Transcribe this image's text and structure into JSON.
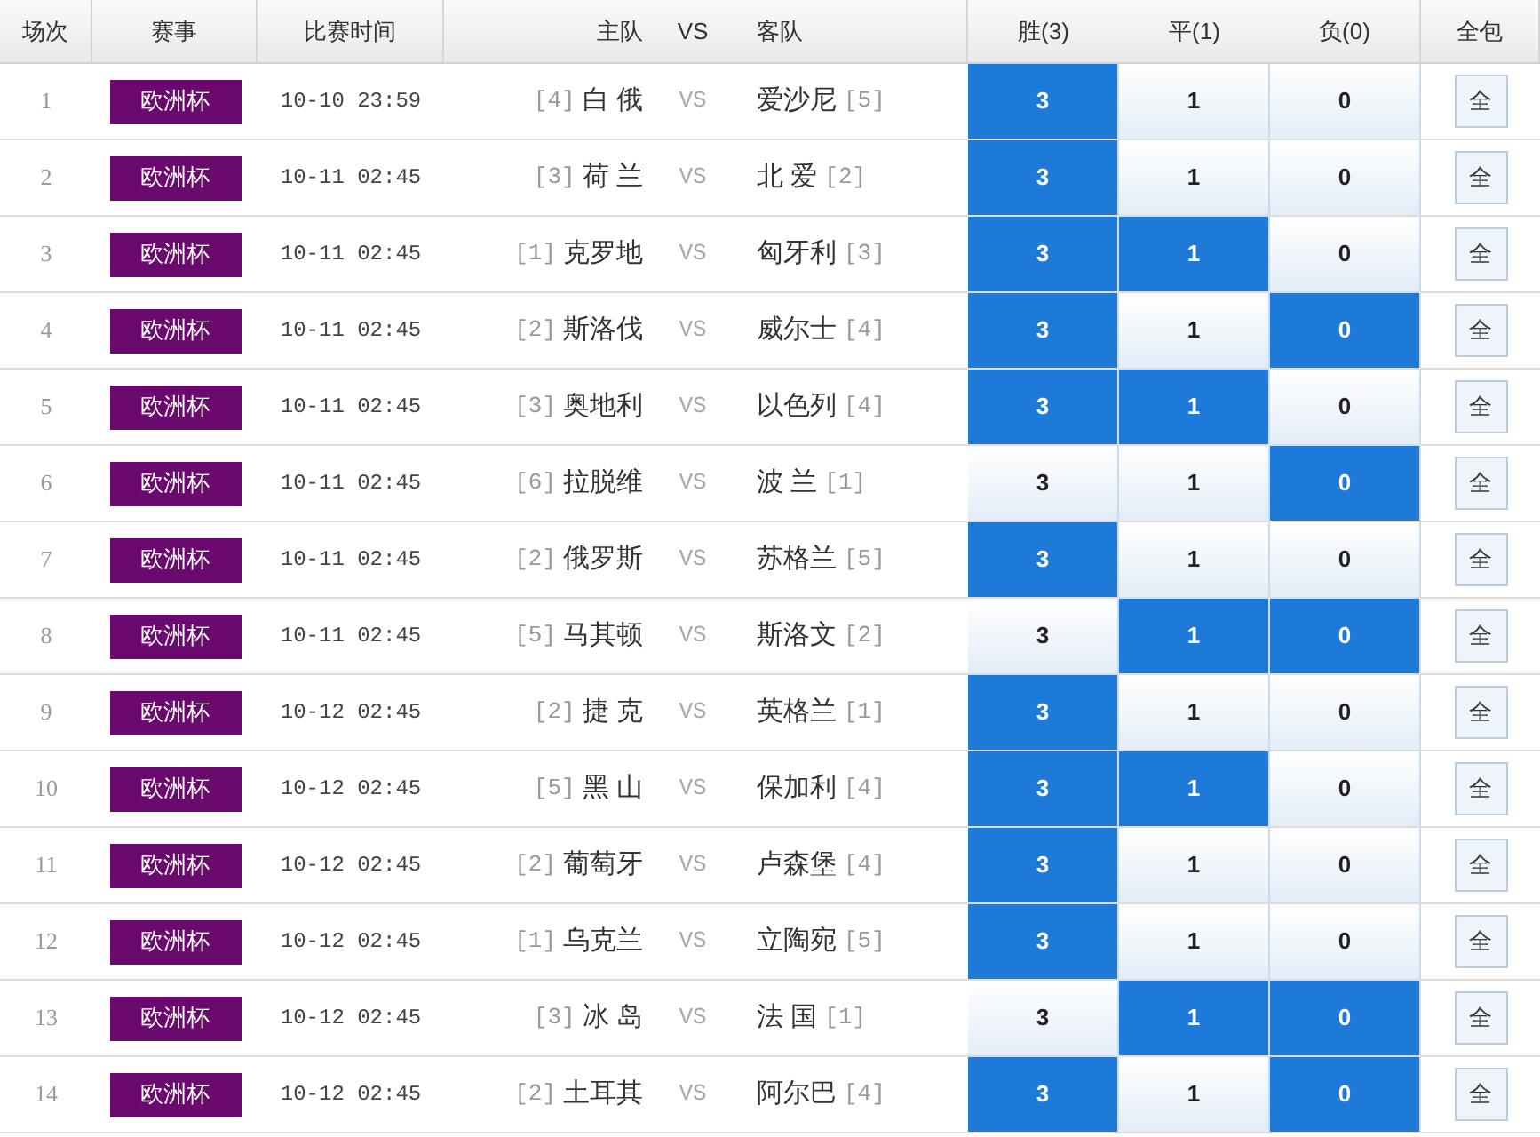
{
  "columns": [
    "场次",
    "赛事",
    "比赛时间",
    "主队",
    "VS",
    "客队",
    "胜(3)",
    "平(1)",
    "负(0)",
    "全包"
  ],
  "rows": [
    {
      "no": "1",
      "league": "欧洲杯",
      "time": "10-10 23:59",
      "home_rank": "[4]",
      "home": "白 俄",
      "vs": "VS",
      "away": "爱沙尼",
      "away_rank": "[5]",
      "odds": [
        {
          "value": "3",
          "selected": true
        },
        {
          "value": "1",
          "selected": false
        },
        {
          "value": "0",
          "selected": false
        }
      ],
      "all": "全"
    },
    {
      "no": "2",
      "league": "欧洲杯",
      "time": "10-11 02:45",
      "home_rank": "[3]",
      "home": "荷 兰",
      "vs": "VS",
      "away": "北 爱",
      "away_rank": "[2]",
      "odds": [
        {
          "value": "3",
          "selected": true
        },
        {
          "value": "1",
          "selected": false
        },
        {
          "value": "0",
          "selected": false
        }
      ],
      "all": "全"
    },
    {
      "no": "3",
      "league": "欧洲杯",
      "time": "10-11 02:45",
      "home_rank": "[1]",
      "home": "克罗地",
      "vs": "VS",
      "away": "匈牙利",
      "away_rank": "[3]",
      "odds": [
        {
          "value": "3",
          "selected": true
        },
        {
          "value": "1",
          "selected": true
        },
        {
          "value": "0",
          "selected": false
        }
      ],
      "all": "全"
    },
    {
      "no": "4",
      "league": "欧洲杯",
      "time": "10-11 02:45",
      "home_rank": "[2]",
      "home": "斯洛伐",
      "vs": "VS",
      "away": "威尔士",
      "away_rank": "[4]",
      "odds": [
        {
          "value": "3",
          "selected": true
        },
        {
          "value": "1",
          "selected": false
        },
        {
          "value": "0",
          "selected": true
        }
      ],
      "all": "全"
    },
    {
      "no": "5",
      "league": "欧洲杯",
      "time": "10-11 02:45",
      "home_rank": "[3]",
      "home": "奥地利",
      "vs": "VS",
      "away": "以色列",
      "away_rank": "[4]",
      "odds": [
        {
          "value": "3",
          "selected": true
        },
        {
          "value": "1",
          "selected": true
        },
        {
          "value": "0",
          "selected": false
        }
      ],
      "all": "全"
    },
    {
      "no": "6",
      "league": "欧洲杯",
      "time": "10-11 02:45",
      "home_rank": "[6]",
      "home": "拉脱维",
      "vs": "VS",
      "away": "波 兰",
      "away_rank": "[1]",
      "odds": [
        {
          "value": "3",
          "selected": false
        },
        {
          "value": "1",
          "selected": false
        },
        {
          "value": "0",
          "selected": true
        }
      ],
      "all": "全"
    },
    {
      "no": "7",
      "league": "欧洲杯",
      "time": "10-11 02:45",
      "home_rank": "[2]",
      "home": "俄罗斯",
      "vs": "VS",
      "away": "苏格兰",
      "away_rank": "[5]",
      "odds": [
        {
          "value": "3",
          "selected": true
        },
        {
          "value": "1",
          "selected": false
        },
        {
          "value": "0",
          "selected": false
        }
      ],
      "all": "全"
    },
    {
      "no": "8",
      "league": "欧洲杯",
      "time": "10-11 02:45",
      "home_rank": "[5]",
      "home": "马其顿",
      "vs": "VS",
      "away": "斯洛文",
      "away_rank": "[2]",
      "odds": [
        {
          "value": "3",
          "selected": false
        },
        {
          "value": "1",
          "selected": true
        },
        {
          "value": "0",
          "selected": true
        }
      ],
      "all": "全"
    },
    {
      "no": "9",
      "league": "欧洲杯",
      "time": "10-12 02:45",
      "home_rank": "[2]",
      "home": "捷 克",
      "vs": "VS",
      "away": "英格兰",
      "away_rank": "[1]",
      "odds": [
        {
          "value": "3",
          "selected": true
        },
        {
          "value": "1",
          "selected": false
        },
        {
          "value": "0",
          "selected": false
        }
      ],
      "all": "全"
    },
    {
      "no": "10",
      "league": "欧洲杯",
      "time": "10-12 02:45",
      "home_rank": "[5]",
      "home": "黑 山",
      "vs": "VS",
      "away": "保加利",
      "away_rank": "[4]",
      "odds": [
        {
          "value": "3",
          "selected": true
        },
        {
          "value": "1",
          "selected": true
        },
        {
          "value": "0",
          "selected": false
        }
      ],
      "all": "全"
    },
    {
      "no": "11",
      "league": "欧洲杯",
      "time": "10-12 02:45",
      "home_rank": "[2]",
      "home": "葡萄牙",
      "vs": "VS",
      "away": "卢森堡",
      "away_rank": "[4]",
      "odds": [
        {
          "value": "3",
          "selected": true
        },
        {
          "value": "1",
          "selected": false
        },
        {
          "value": "0",
          "selected": false
        }
      ],
      "all": "全"
    },
    {
      "no": "12",
      "league": "欧洲杯",
      "time": "10-12 02:45",
      "home_rank": "[1]",
      "home": "乌克兰",
      "vs": "VS",
      "away": "立陶宛",
      "away_rank": "[5]",
      "odds": [
        {
          "value": "3",
          "selected": true
        },
        {
          "value": "1",
          "selected": false
        },
        {
          "value": "0",
          "selected": false
        }
      ],
      "all": "全"
    },
    {
      "no": "13",
      "league": "欧洲杯",
      "time": "10-12 02:45",
      "home_rank": "[3]",
      "home": "冰 岛",
      "vs": "VS",
      "away": "法 国",
      "away_rank": "[1]",
      "odds": [
        {
          "value": "3",
          "selected": false
        },
        {
          "value": "1",
          "selected": true
        },
        {
          "value": "0",
          "selected": true
        }
      ],
      "all": "全"
    },
    {
      "no": "14",
      "league": "欧洲杯",
      "time": "10-12 02:45",
      "home_rank": "[2]",
      "home": "土耳其",
      "vs": "VS",
      "away": "阿尔巴",
      "away_rank": "[4]",
      "odds": [
        {
          "value": "3",
          "selected": true
        },
        {
          "value": "1",
          "selected": false
        },
        {
          "value": "0",
          "selected": true
        }
      ],
      "all": "全"
    }
  ]
}
